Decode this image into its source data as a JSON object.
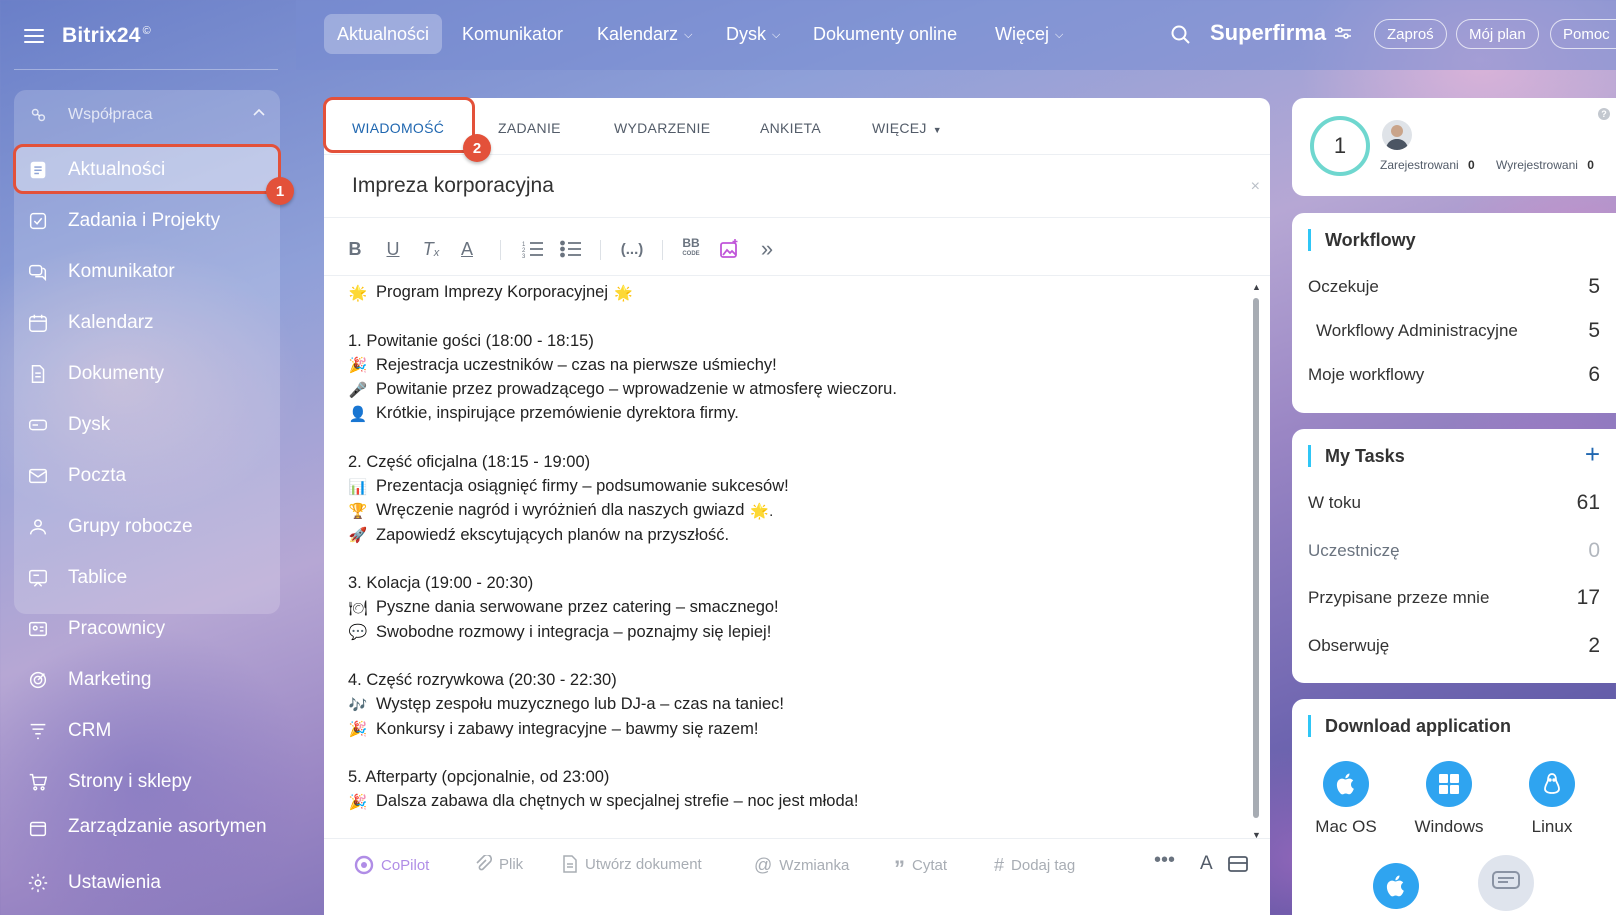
{
  "sidebar": {
    "logo": "Bitrix24",
    "logo_mark": "©",
    "group_label": "Współpraca",
    "items": [
      {
        "label": "Aktualności"
      },
      {
        "label": "Zadania i Projekty"
      },
      {
        "label": "Komunikator"
      },
      {
        "label": "Kalendarz"
      },
      {
        "label": "Dokumenty"
      },
      {
        "label": "Dysk"
      },
      {
        "label": "Poczta"
      },
      {
        "label": "Grupy robocze"
      },
      {
        "label": "Tablice"
      },
      {
        "label": "Pracownicy"
      },
      {
        "label": "Marketing"
      },
      {
        "label": "CRM"
      },
      {
        "label": "Strony i sklepy"
      },
      {
        "label": "Zarządzanie asortymen"
      },
      {
        "label": "Ustawienia"
      }
    ],
    "badge": "1"
  },
  "topbar": {
    "tabs": [
      {
        "label": "Aktualności"
      },
      {
        "label": "Komunikator"
      },
      {
        "label": "Kalendarz"
      },
      {
        "label": "Dysk"
      },
      {
        "label": "Dokumenty online"
      },
      {
        "label": "Więcej"
      }
    ],
    "company": "Superfirma",
    "buttons": [
      "Zaproś",
      "Mój plan",
      "Pomoc"
    ]
  },
  "composer": {
    "tabs": [
      "WIADOMOŚĆ",
      "ZADANIE",
      "WYDARZENIE",
      "ANKIETA",
      "WIĘCEJ"
    ],
    "badge": "2",
    "title": "Impreza korporacyjna",
    "close_glyph": "×",
    "lines": [
      {
        "emoji": "🌟",
        "text": "Program Imprezy Korporacyjnej",
        "emoji_after": "🌟"
      },
      {
        "emoji": "",
        "text": ""
      },
      {
        "emoji": "",
        "text": "1. Powitanie gości (18:00 - 18:15)"
      },
      {
        "emoji": "🎉",
        "text": "Rejestracja uczestników – czas na pierwsze uśmiechy!"
      },
      {
        "emoji": "🎤",
        "text": "Powitanie przez prowadzącego – wprowadzenie w atmosferę wieczoru."
      },
      {
        "emoji": "👤",
        "text": "Krótkie, inspirujące przemówienie dyrektora firmy."
      },
      {
        "emoji": "",
        "text": ""
      },
      {
        "emoji": "",
        "text": "2. Część oficjalna (18:15 - 19:00)"
      },
      {
        "emoji": "📊",
        "text": "Prezentacja osiągnięć firmy – podsumowanie sukcesów!"
      },
      {
        "emoji": "🏆",
        "text": "Wręczenie nagród i wyróżnień dla naszych gwiazd",
        "emoji_after": "🌟."
      },
      {
        "emoji": "🚀",
        "text": "Zapowiedź ekscytujących planów na przyszłość."
      },
      {
        "emoji": "",
        "text": ""
      },
      {
        "emoji": "",
        "text": "3. Kolacja (19:00 - 20:30)"
      },
      {
        "emoji": "🍽",
        "text": "Pyszne dania serwowane przez catering – smacznego!"
      },
      {
        "emoji": "💬",
        "text": "Swobodne rozmowy i integracja – poznajmy się lepiej!"
      },
      {
        "emoji": "",
        "text": ""
      },
      {
        "emoji": "",
        "text": "4. Część rozrywkowa (20:30 - 22:30)"
      },
      {
        "emoji": "🎶",
        "text": "Występ zespołu muzycznego lub DJ-a – czas na taniec!"
      },
      {
        "emoji": "🎉",
        "text": "Konkursy i zabawy integracyjne – bawmy się razem!"
      },
      {
        "emoji": "",
        "text": ""
      },
      {
        "emoji": "",
        "text": "5. Afterparty (opcjonalnie, od 23:00)"
      },
      {
        "emoji": "🎉",
        "text": "Dalsza zabawa dla chętnych w specjalnej strefie – noc jest młoda!"
      }
    ],
    "bottom": {
      "copilot": "CoPilot",
      "file": "Plik",
      "create_doc": "Utwórz dokument",
      "mention": "Wzmianka",
      "quote": "Cytat",
      "tag": "Dodaj tag"
    }
  },
  "stats_widget": {
    "count": "1",
    "registered_label": "Zarejestrowani",
    "registered_value": "0",
    "unregistered_label": "Wyrejestrowani",
    "unregistered_value": "0",
    "help": "?"
  },
  "workflows": {
    "title": "Workflowy",
    "rows": [
      {
        "label": "Oczekuje",
        "value": "5"
      },
      {
        "label": "Workflowy Administracyjne",
        "value": "5"
      },
      {
        "label": "Moje workflowy",
        "value": "6"
      }
    ]
  },
  "tasks": {
    "title": "My Tasks",
    "rows": [
      {
        "label": "W toku",
        "value": "61"
      },
      {
        "label": "Uczestniczę",
        "value": "0"
      },
      {
        "label": "Przypisane przeze mnie",
        "value": "17"
      },
      {
        "label": "Obserwuję",
        "value": "2"
      }
    ]
  },
  "download": {
    "title": "Download application",
    "apps": [
      "Mac OS",
      "Windows",
      "Linux"
    ]
  },
  "colors": {
    "accent": "#2067b0",
    "highlight": "#e3513a",
    "widget_accent": "#2fc6f6",
    "app_blue": "#2fa4f0"
  }
}
